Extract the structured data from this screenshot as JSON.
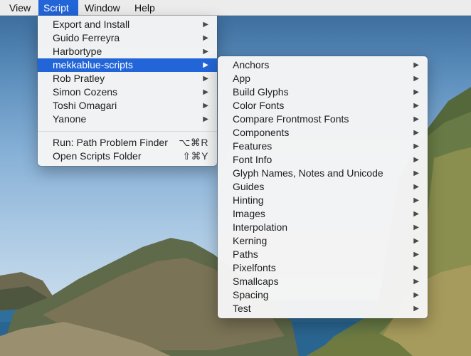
{
  "menubar": {
    "items": [
      {
        "label": "View"
      },
      {
        "label": "Script"
      },
      {
        "label": "Window"
      },
      {
        "label": "Help"
      }
    ]
  },
  "script_menu": {
    "items": [
      {
        "label": "Export and Install",
        "arrow": "▶"
      },
      {
        "label": "Guido Ferreyra",
        "arrow": "▶"
      },
      {
        "label": "Harbortype",
        "arrow": "▶"
      },
      {
        "label": "mekkablue-scripts",
        "arrow": "▶"
      },
      {
        "label": "Rob Pratley",
        "arrow": "▶"
      },
      {
        "label": "Simon Cozens",
        "arrow": "▶"
      },
      {
        "label": "Toshi Omagari",
        "arrow": "▶"
      },
      {
        "label": "Yanone",
        "arrow": "▶"
      }
    ],
    "actions": [
      {
        "label": "Run: Path Problem Finder",
        "shortcut": "⌥⌘R"
      },
      {
        "label": "Open Scripts Folder",
        "shortcut": "⇧⌘Y"
      }
    ]
  },
  "submenu": {
    "items": [
      {
        "label": "Anchors",
        "arrow": "▶"
      },
      {
        "label": "App",
        "arrow": "▶"
      },
      {
        "label": "Build Glyphs",
        "arrow": "▶"
      },
      {
        "label": "Color Fonts",
        "arrow": "▶"
      },
      {
        "label": "Compare Frontmost Fonts",
        "arrow": "▶"
      },
      {
        "label": "Components",
        "arrow": "▶"
      },
      {
        "label": "Features",
        "arrow": "▶"
      },
      {
        "label": "Font Info",
        "arrow": "▶"
      },
      {
        "label": "Glyph Names, Notes and Unicode",
        "arrow": "▶"
      },
      {
        "label": "Guides",
        "arrow": "▶"
      },
      {
        "label": "Hinting",
        "arrow": "▶"
      },
      {
        "label": "Images",
        "arrow": "▶"
      },
      {
        "label": "Interpolation",
        "arrow": "▶"
      },
      {
        "label": "Kerning",
        "arrow": "▶"
      },
      {
        "label": "Paths",
        "arrow": "▶"
      },
      {
        "label": "Pixelfonts",
        "arrow": "▶"
      },
      {
        "label": "Smallcaps",
        "arrow": "▶"
      },
      {
        "label": "Spacing",
        "arrow": "▶"
      },
      {
        "label": "Test",
        "arrow": "▶"
      }
    ]
  },
  "colors": {
    "highlight": "#2265d8",
    "menu_background": "#f4f4f4",
    "menubar_background": "#ececec"
  }
}
